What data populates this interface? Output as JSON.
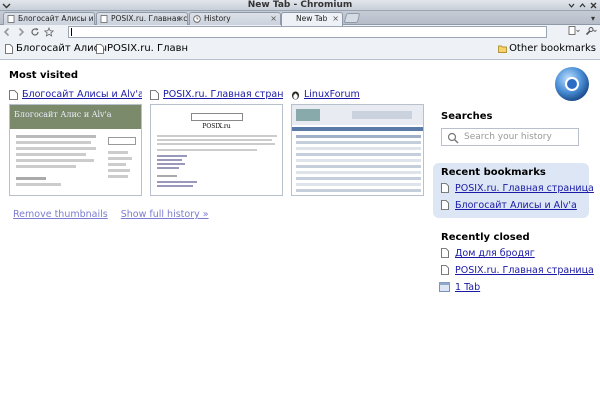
{
  "window": {
    "title": "New Tab - Chromium"
  },
  "tabs": [
    {
      "label": "Блогосайт Алисы и Al..."
    },
    {
      "label": "POSIX.ru. Главная ст..."
    },
    {
      "label": "History"
    },
    {
      "label": "New Tab"
    }
  ],
  "toolbar": {
    "address_value": ""
  },
  "bookmarks_bar": {
    "items": [
      {
        "label": "Блогосайт Алисы"
      },
      {
        "label": "POSIX.ru. Главн"
      }
    ],
    "other": "Other bookmarks"
  },
  "most_visited": {
    "heading": "Most visited",
    "thumbs": [
      {
        "title": "Блогосайт Алисы и Alv'a",
        "page_heading": "Блогосайт Алис и Alv'a"
      },
      {
        "title": "POSIX.ru. Главная страница",
        "page_heading": "POSIX.ru"
      },
      {
        "title": "LinuxForum"
      }
    ],
    "remove_label": "Remove thumbnails",
    "history_label": "Show full history »"
  },
  "searches": {
    "heading": "Searches",
    "placeholder": "Search your history"
  },
  "recent_bookmarks": {
    "heading": "Recent bookmarks",
    "items": [
      {
        "label": "POSIX.ru. Главная страница"
      },
      {
        "label": "Блогосайт Алисы и Alv'a"
      }
    ]
  },
  "recently_closed": {
    "heading": "Recently closed",
    "items": [
      {
        "label": "Дом для бродяг"
      },
      {
        "label": "POSIX.ru. Главная страница"
      },
      {
        "label": "1 Tab"
      }
    ]
  }
}
